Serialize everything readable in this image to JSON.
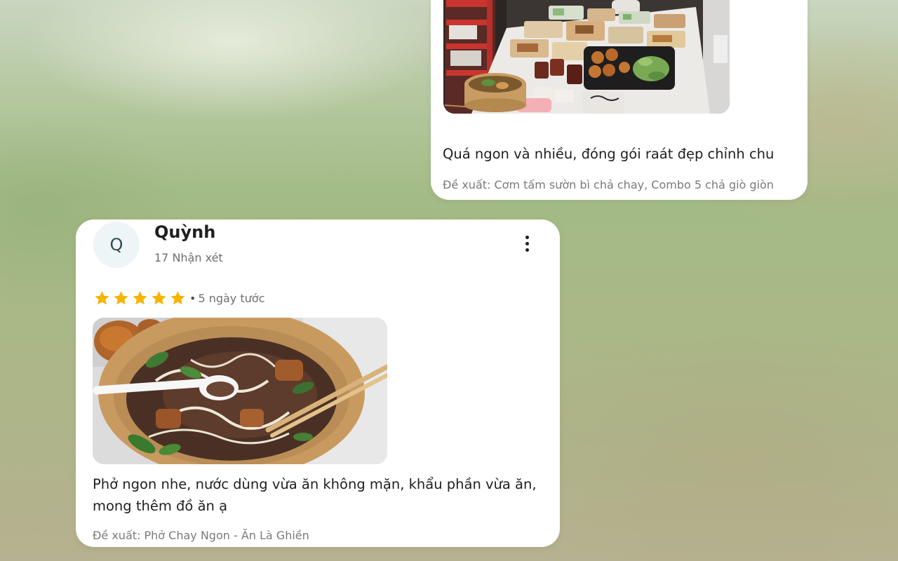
{
  "top_review": {
    "comment": "Quá ngon và nhiều, đóng gói raát đẹp chỉnh chu",
    "suggestion": "Đề xuất: Cơm tấm sườn bì chả chay, Combo 5 chả giò giòn"
  },
  "bottom_review": {
    "avatar_initial": "Q",
    "reviewer_name": "Quỳnh",
    "review_count": "17 Nhận xét",
    "rating": 5,
    "rating_max": 5,
    "separator": "•",
    "time_ago": "5 ngày tước",
    "comment": "Phở ngon nhe, nước dùng vừa ăn không mặn, khẩu phần vừa ăn, mong thêm đồ ăn ạ",
    "suggestion": "Đề xuất: Phở Chay Ngon - Ăn Là Ghiền"
  },
  "colors": {
    "star": "#f6b400",
    "card_bg": "#ffffff",
    "avatar_bg": "#eef5f6"
  },
  "icons": {
    "more": "more-vert-icon",
    "star": "star-icon"
  }
}
